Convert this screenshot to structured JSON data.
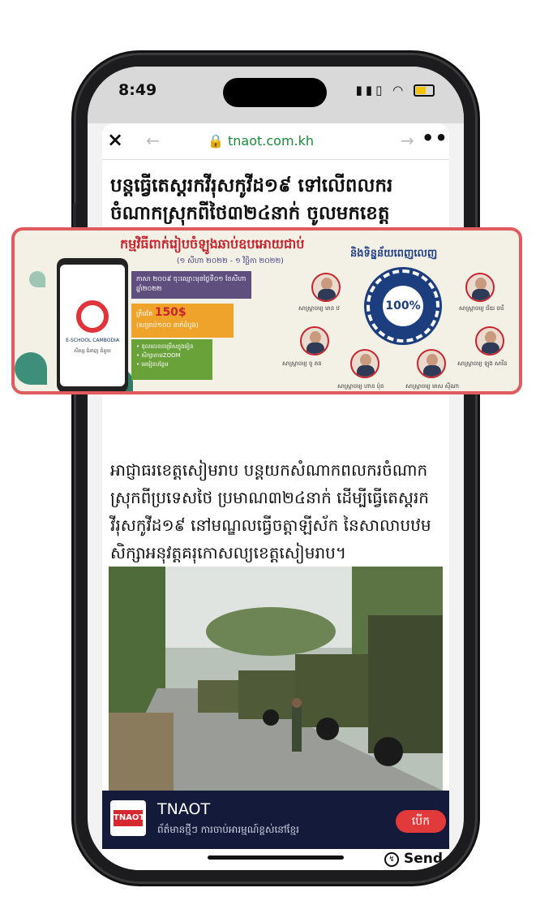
{
  "status_bar": {
    "time": "8:49",
    "signal": "▮▮▯",
    "wifi": "◠"
  },
  "browser": {
    "close_icon": "×",
    "back_icon": "←",
    "forward_icon": "→",
    "more_icon": "•••",
    "url": "🔒 tnaot.com.kh"
  },
  "article": {
    "headline": "បន្តធ្វើតេស្តរកវីរុសកូវីដ១៩ ទៅលើពលករចំណាកស្រុកពីថៃ៣២៤នាក់ ចូលមកខេត្ត",
    "body": "អាជ្ញាធរខេត្តសៀមរាប បន្តយកសំណាកពលករចំណាកស្រុកពីប្រទេសថៃ ប្រមាណ៣២៤នាក់ ដើម្បីធ្វើតេស្តរកវីរុសកូវីដ១៩ នៅមណ្ឌលធ្វើចត្តាឡីស័ក នៃសាលាបឋមសិក្សាអនុវត្តគរុកោសល្យខេត្តសៀមរាប។"
  },
  "app_banner": {
    "logo_text": "TNAOT",
    "name": "TNAOT",
    "tagline": "ព័ត៌មានថ្មីៗ ការចាប់អារម្មណ៍ខ្ពស់នៅខ្មែរ",
    "open_label": "បើក"
  },
  "share": {
    "send_label": "Send"
  },
  "ad": {
    "title": "កម្មវិធីពាក់់រៀបចំឡូងឆាប់ឧបអោយជាប់",
    "dates": "(១ សីហា ២០២២ - ១ វិច្ឆិកា ២០២២)",
    "box1": "ភាសា ២០០៩ ចុះឈ្មោះមុនថ្ងៃទី០១ ខែសីហា ឆ្នាំ២០២២",
    "price": "150$",
    "box2_prefix": "ត្រឹមតែ",
    "box2_suffix": "(សម្រាប់១០០ នាក់ដំបូង)",
    "box3": "• ឌុលលេខជម្រើសក្នុងរៀន\n• សិក្សាតាមZOOM\n• មេរៀនបន្ថែម",
    "right_title": "និងទិន្នន័យពេញលេញ",
    "badge": "100%",
    "logo_caption": "E-SCHOOL CAMBODIA",
    "logo_sub": "សិស្ស ជំនាញ ជំនួយ",
    "teachers": [
      "សាស្ត្រាចារ្យ មាន ឋ",
      "សាស្ត្រាចារ្យ ជ័យ ចារី",
      "សាស្ត្រាចារ្យ ចូ គន",
      "សាស្ត្រាចារ្យ ហាន ប៉ុន",
      "សាស្ត្រាចារ្យ មាស ស៊ីណា",
      "សាស្ត្រាចារ្យ ឡុង សារីន"
    ]
  }
}
